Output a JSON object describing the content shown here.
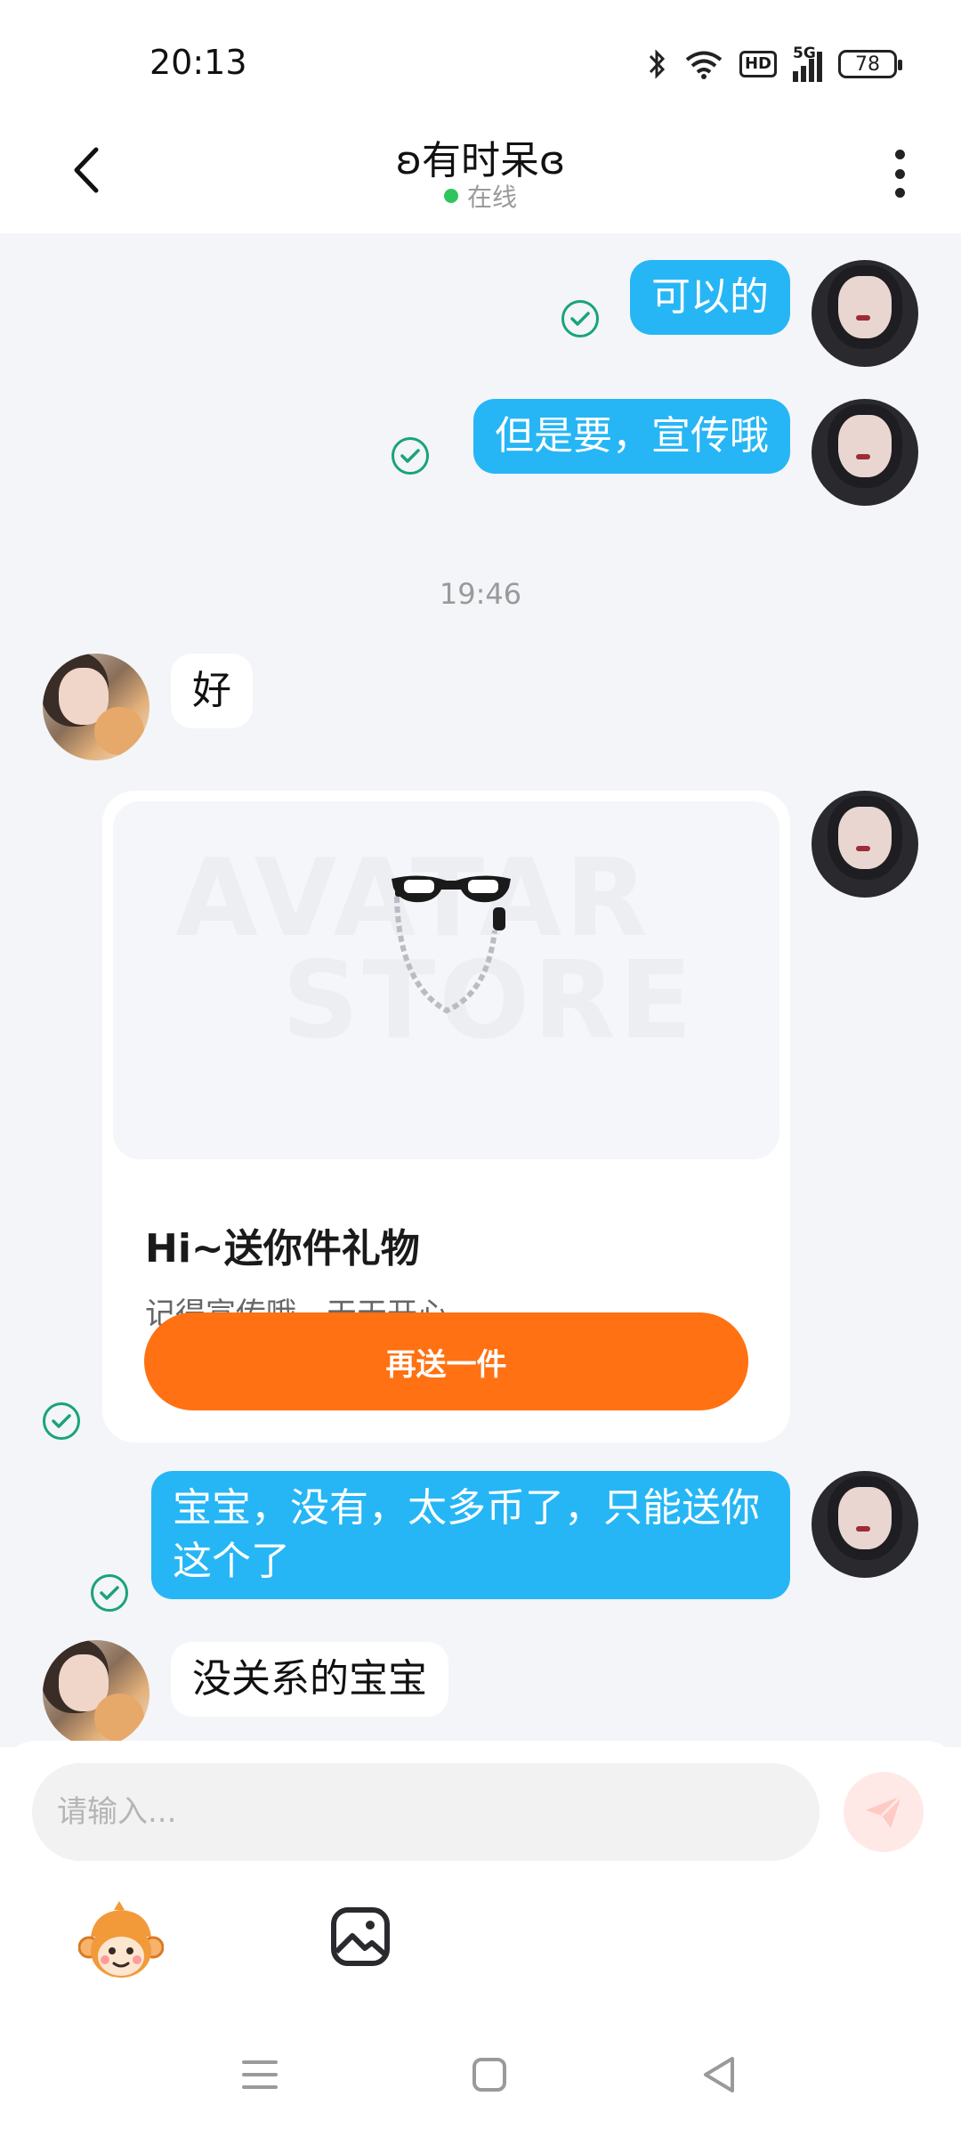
{
  "status_bar": {
    "time": "20:13",
    "network": "5G",
    "hd": "HD",
    "battery": "78"
  },
  "header": {
    "title": "ʚ有时呆ɞ",
    "status": "在线",
    "status_color": "#2ec55e"
  },
  "messages": [
    {
      "sender": "me",
      "text": "可以的",
      "read": true
    },
    {
      "sender": "me",
      "text": "但是要，宣传哦",
      "read": true
    },
    {
      "type": "timestamp",
      "text": "19:46"
    },
    {
      "sender": "other",
      "text": "好"
    },
    {
      "sender": "me",
      "type": "gift",
      "read": true
    },
    {
      "sender": "me",
      "text": "宝宝，没有，太多币了，只能送你这个了",
      "read": true
    },
    {
      "sender": "other",
      "text": "没关系的宝宝"
    }
  ],
  "gift_card": {
    "watermark_line1": "AVATAR",
    "watermark_line2": "STORE",
    "item_icon": "sunglasses-with-chain",
    "title": "Hi~送你件礼物",
    "subtitle": "记得宣传哦，天天开心",
    "button_label": "再送一件",
    "button_color": "#ff7112"
  },
  "input": {
    "placeholder": "请输入..."
  },
  "toolbar": {
    "sticker_icon": "monkey-sticker-icon",
    "image_icon": "image-icon",
    "send_icon": "paper-plane-icon"
  },
  "colors": {
    "my_bubble": "#26b6f5",
    "chat_background": "#f3f5f8",
    "read_check": "#1aa37a"
  }
}
